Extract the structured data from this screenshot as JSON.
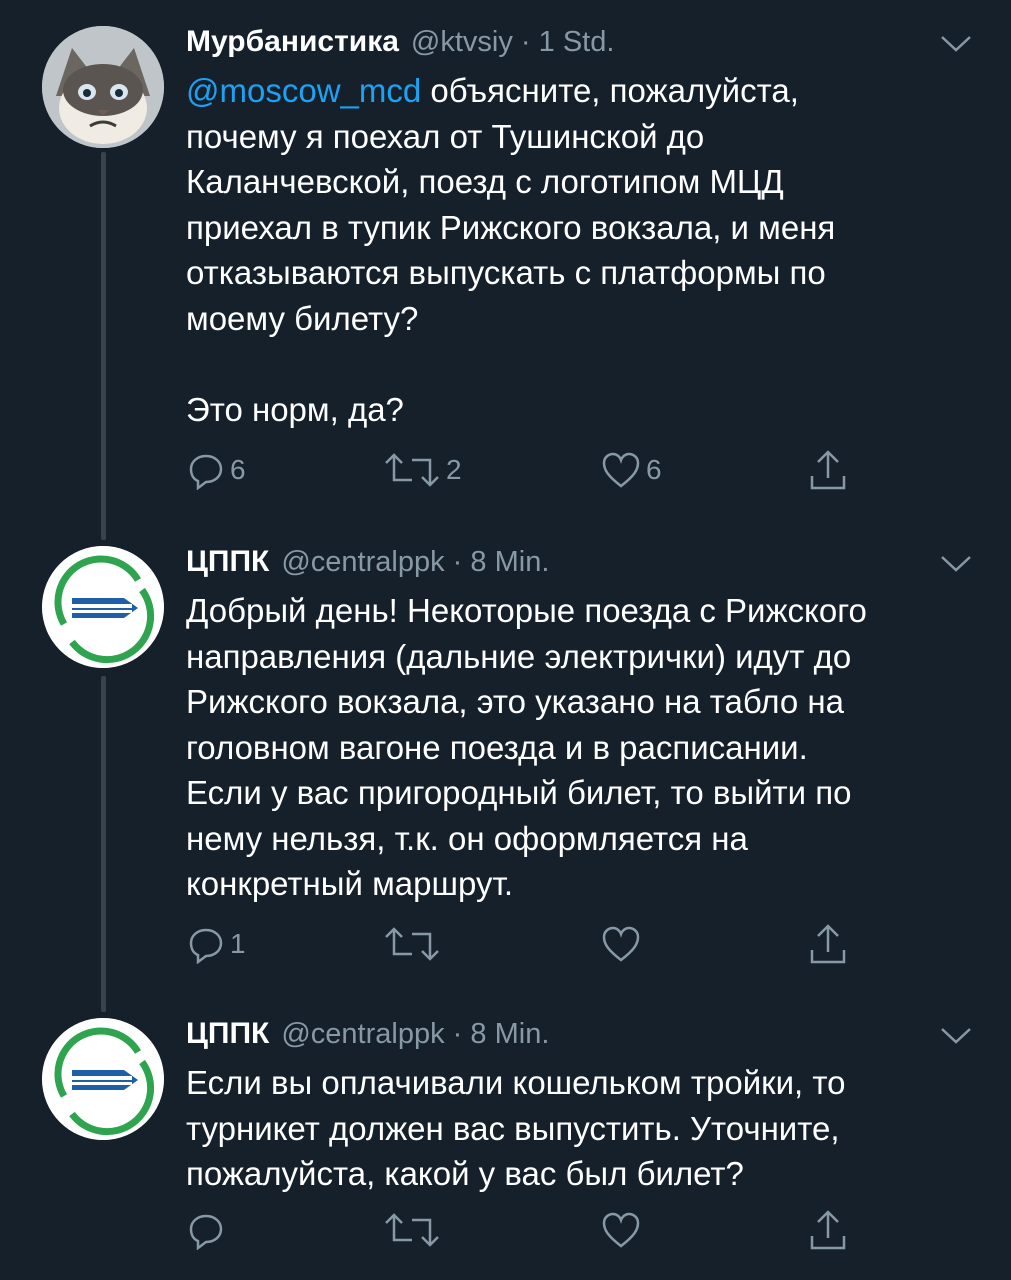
{
  "tweets": [
    {
      "name": "Мурбанистика",
      "handle": "@ktvsiy",
      "time": "1 Std.",
      "mention": "@moscow_mcd",
      "text": " объясните, пожалуйста,\nпочему я поехал от Тушинской до\nКаланчевской, поезд с логотипом МЦД\nприехал в тупик Рижского вокзала, и меня\nотказываются выпускать с платформы по\nмоему билету?\n\nЭто норм, да?",
      "replies": "6",
      "retweets": "2",
      "likes": "6"
    },
    {
      "name": "ЦППК",
      "handle": "@centralppk",
      "time": "8 Min.",
      "text": "Добрый день! Некоторые поезда с Рижского\nнаправления (дальние электрички) идут до\nРижского вокзала, это указано на табло на\nголовном вагоне поезда и в расписании.\nЕсли у вас пригородный билет, то выйти по\nнему нельзя, т.к. он оформляется на\nконкретный маршрут.",
      "replies": "1",
      "retweets": "",
      "likes": ""
    },
    {
      "name": "ЦППК",
      "handle": "@centralppk",
      "time": "8 Min.",
      "text": "Если вы оплачивали кошельком тройки, то\nтурникет должен вас выпустить. Уточните,\nпожалуйста, какой у вас был билет?",
      "replies": "",
      "retweets": "",
      "likes": ""
    }
  ],
  "separator": "·",
  "colors": {
    "background": "#15202b",
    "muted": "#8899a6",
    "link": "#1da1f2",
    "thread": "#38444d",
    "logo_green": "#2ea44f",
    "logo_blue": "#1f5fa8"
  }
}
